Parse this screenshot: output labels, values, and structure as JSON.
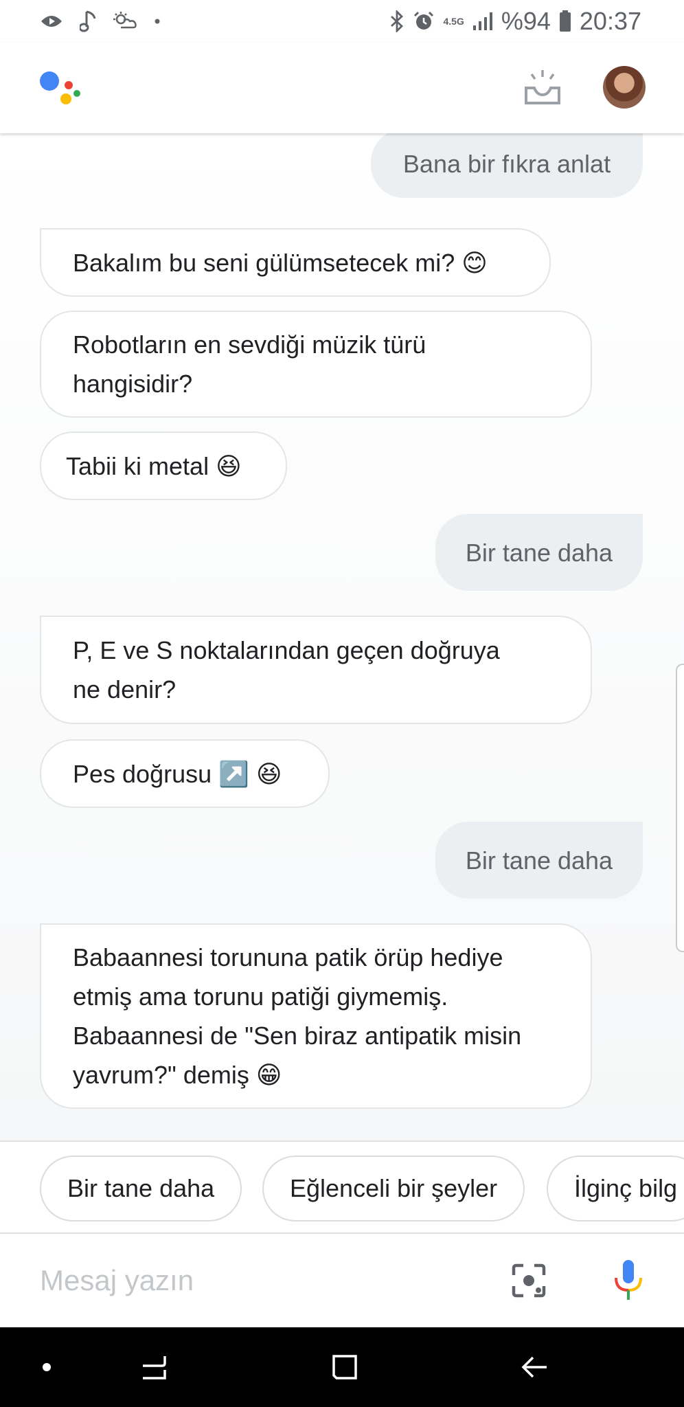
{
  "status_bar": {
    "network_type": "4.5G",
    "battery": "%94",
    "time": "20:37",
    "left_icons": [
      "play-icon",
      "music-note-icon",
      "weather-icon",
      "dot-icon"
    ],
    "right_icons": [
      "bluetooth-icon",
      "alarm-icon",
      "signal-icon",
      "battery-icon"
    ]
  },
  "header": {
    "logo_colors": [
      "#4285F4",
      "#EA4335",
      "#FBBC05",
      "#34A853"
    ],
    "updates_icon": "updates-tray-icon",
    "avatar": "user-avatar"
  },
  "conversation": {
    "messages": [
      {
        "from": "user",
        "text": "Bana bir fıkra anlat"
      },
      {
        "from": "assistant",
        "text": "Bakalım bu seni gülümsetecek mi? 😊"
      },
      {
        "from": "assistant",
        "text": "Robotların en sevdiği müzik türü\nhangisidir?"
      },
      {
        "from": "assistant",
        "text": "Tabii ki metal 😆"
      },
      {
        "from": "user",
        "text": "Bir tane daha"
      },
      {
        "from": "assistant",
        "text": "P, E ve S noktalarından geçen doğruya\nne denir?"
      },
      {
        "from": "assistant",
        "text": "Pes doğrusu ↗️ 😆"
      },
      {
        "from": "user",
        "text": "Bir tane daha"
      },
      {
        "from": "assistant",
        "text": "Babaannesi torununa patik örüp hediye\netmiş ama torunu patiği giymemiş.\nBabaannesi de \"Sen biraz antipatik misin\nyavrum?\" demiş 😁"
      }
    ]
  },
  "suggestions": [
    "Bir tane daha",
    "Eğlenceli bir şeyler",
    "İlginç bilg"
  ],
  "input": {
    "placeholder": "Mesaj yazın",
    "value": "",
    "lens_icon": "lens-icon",
    "mic_icon": "mic-icon"
  },
  "nav_bar": {
    "items": [
      "dot-icon",
      "recents-icon",
      "home-icon",
      "back-icon"
    ]
  }
}
